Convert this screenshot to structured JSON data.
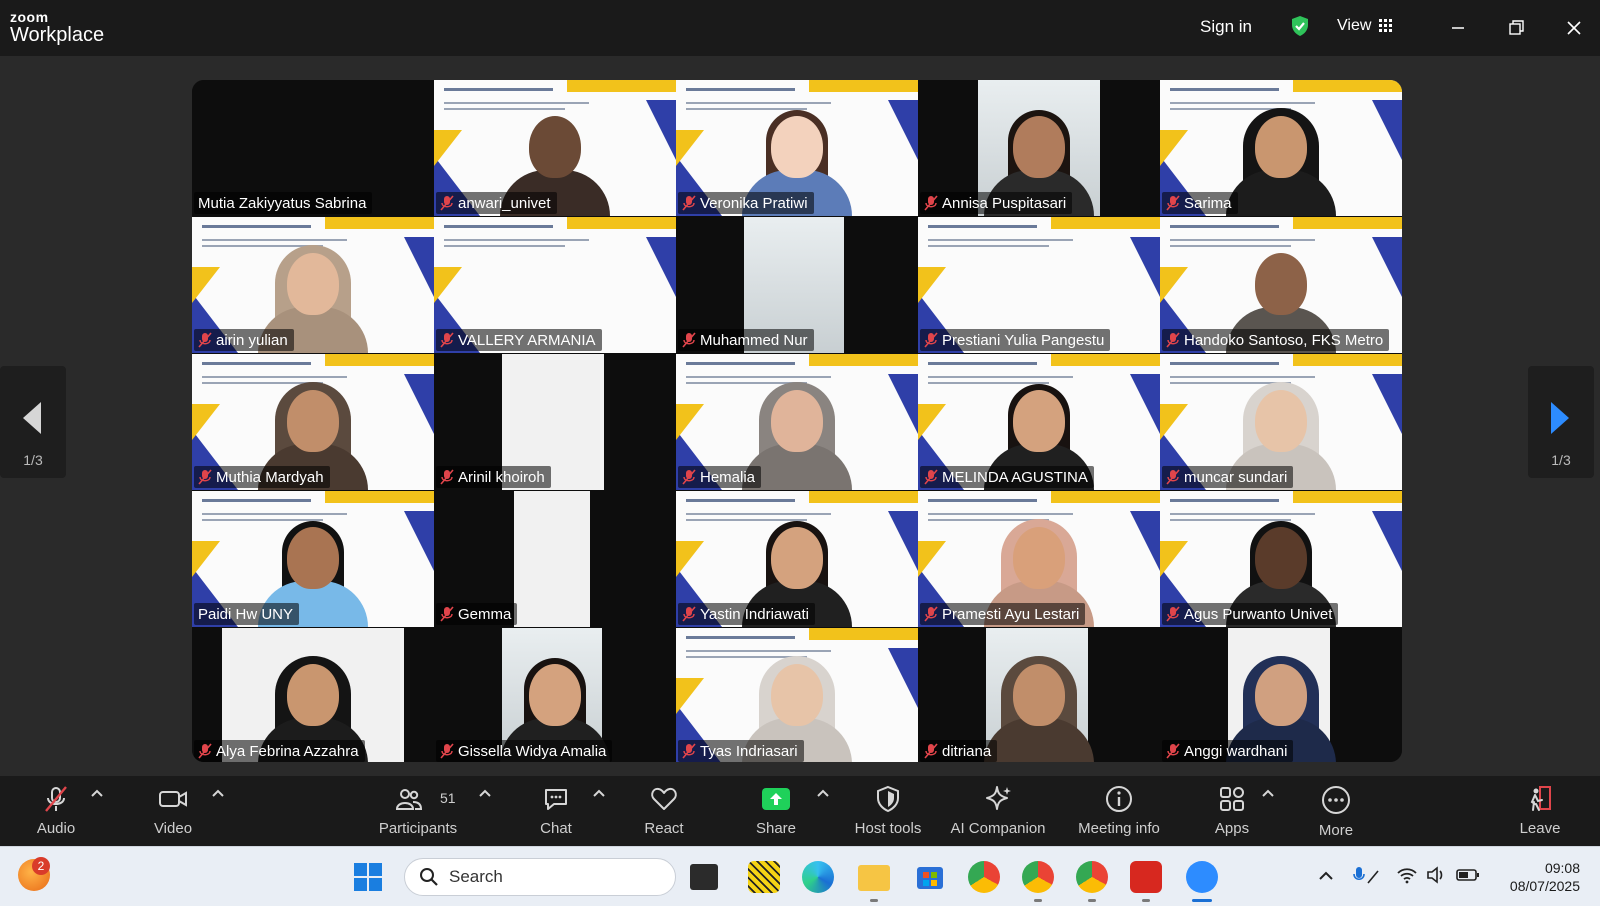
{
  "app": {
    "brand_top": "zoom",
    "brand_bottom": "Workplace"
  },
  "titlebar": {
    "sign_in": "Sign in",
    "view": "View"
  },
  "pager": {
    "label": "1/3"
  },
  "participants": [
    "Mutia Zakiyyatus Sabrina",
    "anwari_univet",
    "Veronika Pratiwi",
    "Annisa Puspitasari",
    "Sarima",
    "airin yulian",
    "VALLERY ARMANIA",
    "Muhammed Nur",
    "Prestiani Yulia Pangestu",
    "Handoko Santoso, FKS Metro",
    "Muthia Mardyah",
    "Arinil khoiroh",
    "Hemalia",
    "MELINDA AGUSTINA",
    "muncar sundari",
    "Paidi Hw UNY",
    "Gemma",
    "Yastin Indriawati",
    "Pramesti Ayu Lestari",
    "Agus Purwanto Univet",
    "Alya Febrina Azzahra",
    "Gissella Widya Amalia",
    "Tyas Indriasari",
    "ditriana",
    "Anggi wardhani"
  ],
  "toolbar": {
    "audio": "Audio",
    "video": "Video",
    "participants": "Participants",
    "participants_count": "51",
    "chat": "Chat",
    "react": "React",
    "share": "Share",
    "host_tools": "Host tools",
    "ai_companion": "AI Companion",
    "meeting_info": "Meeting info",
    "apps": "Apps",
    "more": "More",
    "leave": "Leave"
  },
  "taskbar": {
    "search_placeholder": "Search",
    "notification_count": "2",
    "time": "09:08",
    "date": "08/07/2025"
  }
}
